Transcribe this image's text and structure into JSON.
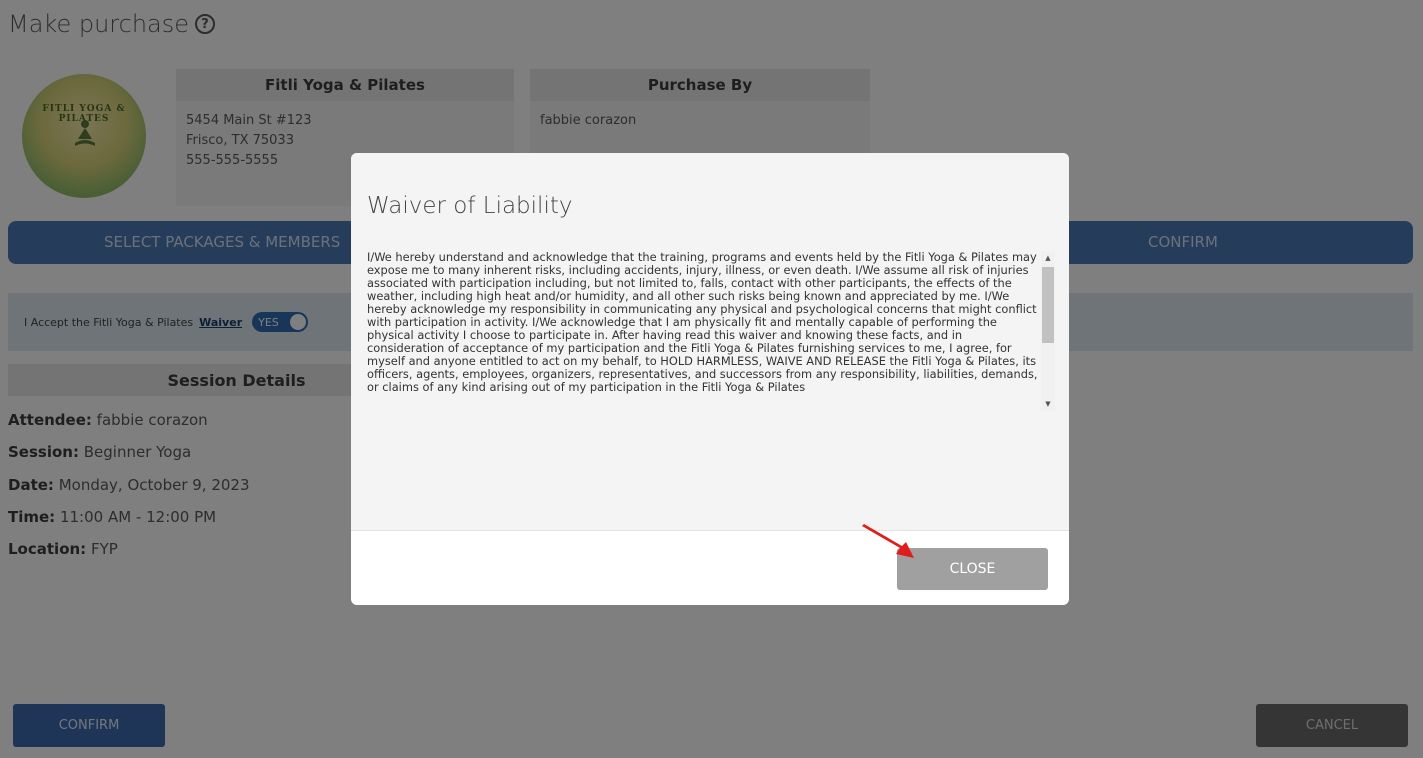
{
  "page": {
    "title": "Make purchase"
  },
  "studio": {
    "name": "Fitli Yoga & Pilates",
    "address_line1": "5454 Main St #123",
    "address_line2": "Frisco, TX 75033",
    "phone": "555-555-5555",
    "logo_text": "FITLI YOGA & PILATES"
  },
  "purchaser": {
    "header": "Purchase By",
    "name": "fabbie corazon"
  },
  "steps": {
    "step1": "SELECT PACKAGES & MEMBERS",
    "step3": "CONFIRM"
  },
  "waiver_row": {
    "label": "I Accept the Fitli Yoga & Pilates",
    "link": "Waiver",
    "toggle": "YES"
  },
  "session": {
    "header": "Session Details",
    "attendee_label": "Attendee:",
    "attendee": "fabbie corazon",
    "session_label": "Session:",
    "session": "Beginner Yoga",
    "date_label": "Date:",
    "date": "Monday, October 9, 2023",
    "time_label": "Time:",
    "time": "11:00 AM - 12:00 PM",
    "location_label": "Location:",
    "location": "FYP"
  },
  "footer": {
    "confirm": "CONFIRM",
    "cancel": "CANCEL"
  },
  "modal": {
    "title": "Waiver of Liability",
    "text": "I/We hereby understand and acknowledge that the training, programs and events held by the Fitli Yoga & Pilates may expose me to many inherent risks, including accidents, injury, illness, or even death. I/We assume all risk of injuries associated with participation including, but not limited to, falls, contact with other participants, the effects of the weather, including high heat and/or humidity, and all other such risks being known and appreciated by me. I/We hereby acknowledge my responsibility in communicating any physical and psychological concerns that might conflict with participation in activity. I/We acknowledge that I am physically fit and mentally capable of performing the physical activity I choose to participate in. After having read this waiver and knowing these facts, and in consideration of acceptance of my participation and the Fitli Yoga & Pilates furnishing services to me, I agree, for myself and anyone entitled to act on my behalf, to HOLD HARMLESS, WAIVE AND RELEASE the Fitli Yoga & Pilates, its officers, agents, employees, organizers, representatives, and successors from any responsibility, liabilities, demands, or claims of any kind arising out of my participation in the Fitli Yoga & Pilates",
    "close": "CLOSE"
  },
  "colors": {
    "primary": "#3d6bb0",
    "annotation_arrow": "#e01d1d",
    "close_button": "#a0a0a0"
  }
}
